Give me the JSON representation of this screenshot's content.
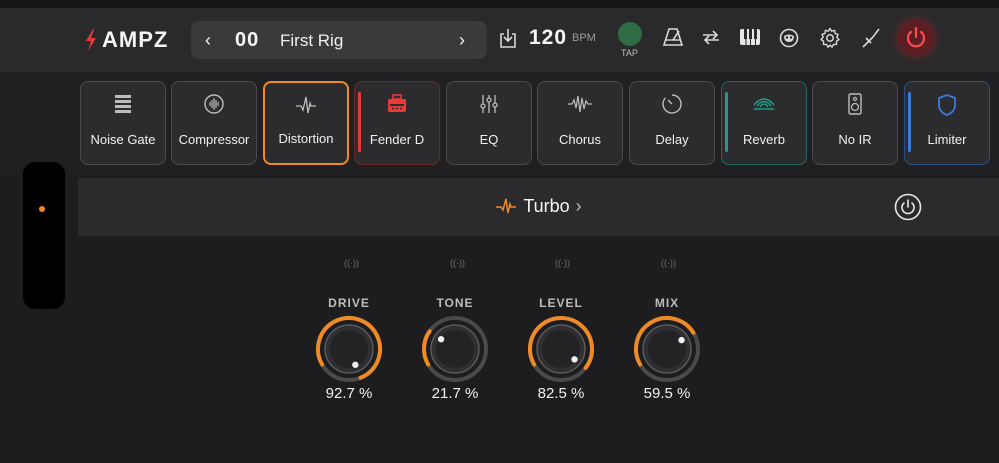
{
  "app": {
    "name": "AMPZ"
  },
  "rig": {
    "number": "00",
    "name": "First Rig"
  },
  "tempo": {
    "bpm": "120",
    "unit": "BPM",
    "tap_label": "TAP"
  },
  "colors": {
    "accent": "#f08a24",
    "brand": "#e83a3a",
    "teal": "#1e9c86",
    "blue": "#3b7be0",
    "tap": "#2f6b43"
  },
  "toolbar_icons": [
    "import-icon",
    "metronome-icon",
    "loop-icon",
    "keyboard-icon",
    "mask-icon",
    "gear-icon",
    "tuner-icon",
    "power-icon"
  ],
  "effects": [
    {
      "label": "Noise Gate",
      "icon": "noise-gate-icon"
    },
    {
      "label": "Compressor",
      "icon": "compressor-icon"
    },
    {
      "label": "Distortion",
      "icon": "waveform-icon",
      "active": true
    },
    {
      "label": "Fender D",
      "icon": "amp-icon"
    },
    {
      "label": "EQ",
      "icon": "sliders-icon"
    },
    {
      "label": "Chorus",
      "icon": "chorus-icon"
    },
    {
      "label": "Delay",
      "icon": "delay-icon"
    },
    {
      "label": "Reverb",
      "icon": "reverb-icon"
    },
    {
      "label": "No IR",
      "icon": "speaker-icon"
    },
    {
      "label": "Limiter",
      "icon": "shield-icon"
    }
  ],
  "effect_panel": {
    "title": "Turbo"
  },
  "knobs": [
    {
      "label": "DRIVE",
      "value": 92.7,
      "display": "92.7 %"
    },
    {
      "label": "TONE",
      "value": 21.7,
      "display": "21.7 %"
    },
    {
      "label": "LEVEL",
      "value": 82.5,
      "display": "82.5 %"
    },
    {
      "label": "MIX",
      "value": 59.5,
      "display": "59.5 %"
    }
  ],
  "midi_icon_glyph": "((·))"
}
